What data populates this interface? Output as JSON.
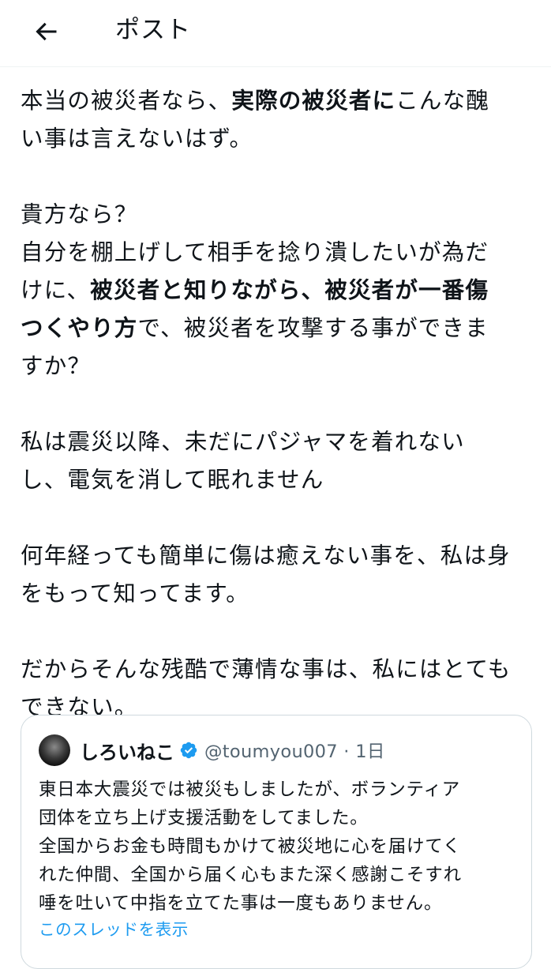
{
  "header": {
    "back_icon": "arrow-left-icon",
    "title": "ポスト"
  },
  "post": {
    "paragraphs": [
      {
        "lines": [
          [
            {
              "t": "本当の被災者なら、",
              "b": false
            },
            {
              "t": "実際の被災者に",
              "b": true
            },
            {
              "t": "こんな醜",
              "b": false
            }
          ],
          [
            {
              "t": "い事は言えないはず。",
              "b": false
            }
          ]
        ]
      },
      {
        "lines": [
          [
            {
              "t": "貴方なら？",
              "b": false
            }
          ],
          [
            {
              "t": "自分を棚上げして相手を捻り潰したいが為だ",
              "b": false
            }
          ],
          [
            {
              "t": "けに、",
              "b": false
            },
            {
              "t": "被災者と知りながら、被災者が一番傷",
              "b": true
            }
          ],
          [
            {
              "t": "つくやり方",
              "b": true
            },
            {
              "t": "で、被災者を攻撃する事ができま",
              "b": false
            }
          ],
          [
            {
              "t": "すか？",
              "b": false
            }
          ]
        ]
      },
      {
        "lines": [
          [
            {
              "t": "私は震災以降、未だにパジャマを着れない",
              "b": false
            }
          ],
          [
            {
              "t": "し、電気を消して眠れません",
              "b": false
            }
          ]
        ]
      },
      {
        "lines": [
          [
            {
              "t": "何年経っても簡単に傷は癒えない事を、私は身",
              "b": false
            }
          ],
          [
            {
              "t": "をもって知ってます。",
              "b": false
            }
          ]
        ]
      },
      {
        "lines": [
          [
            {
              "t": "だからそんな残酷で薄情な事は、私にはとても",
              "b": false
            }
          ],
          [
            {
              "t": "できない。",
              "b": false
            }
          ]
        ]
      }
    ]
  },
  "quote": {
    "name": "しろいねこ",
    "verified_icon": "verified-badge-icon",
    "handle_meta": "@toumyou007 · 1日",
    "lines": [
      "東日本大震災では被災もしましたが、ボランティア",
      "団体を立ち上げ支援活動をしてました。",
      "全国からお金も時間もかけて被災地に心を届けてく",
      "れた仲間、全国から届く心もまた深く感謝こそすれ",
      "唾を吐いて中指を立てた事は一度もありません。"
    ],
    "show_thread": "このスレッドを表示"
  },
  "colors": {
    "text": "#0f1419",
    "secondary": "#536471",
    "link": "#1d9bf0",
    "border": "#cfd9de"
  }
}
